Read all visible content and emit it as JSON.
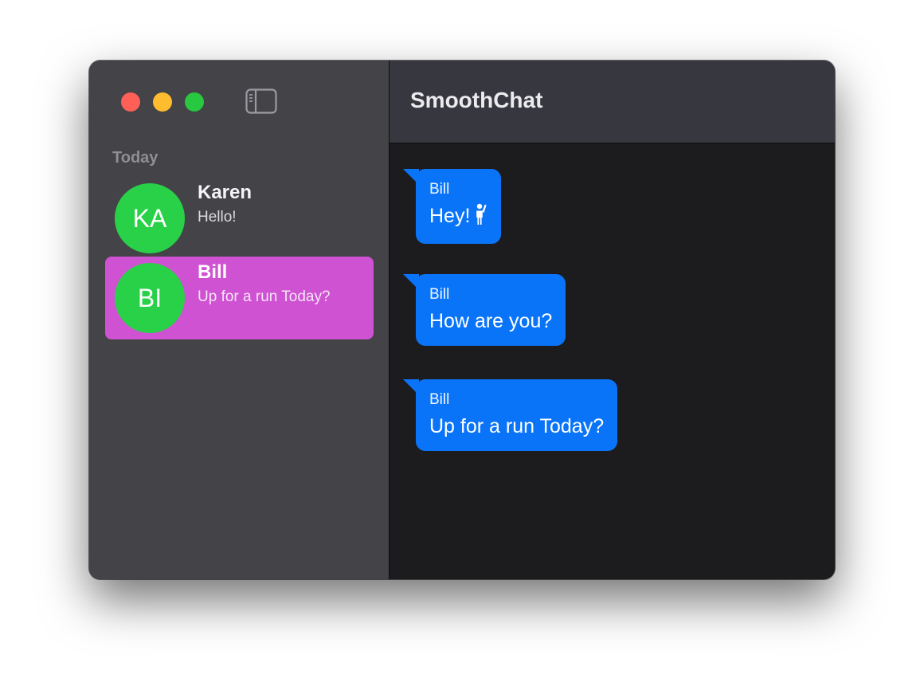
{
  "window": {
    "traffic_lights": [
      "close",
      "minimize",
      "zoom"
    ],
    "sidebar_toggle_icon": "sidebar-toggle-icon"
  },
  "sidebar": {
    "section_header": "Today",
    "conversations": [
      {
        "initials": "KA",
        "name": "Karen",
        "preview": "Hello!",
        "selected": false,
        "avatar_color": "#29d148"
      },
      {
        "initials": "BI",
        "name": "Bill",
        "preview": "Up for a run Today?",
        "selected": true,
        "avatar_color": "#29d148",
        "highlight_color": "#cf52d2"
      }
    ]
  },
  "main": {
    "title": "SmoothChat",
    "messages": [
      {
        "sender": "Bill",
        "text": "Hey!",
        "icon": "person-raising-hand-icon"
      },
      {
        "sender": "Bill",
        "text": "How are you?"
      },
      {
        "sender": "Bill",
        "text": "Up for a run Today?"
      }
    ]
  },
  "colors": {
    "accent_blue": "#0a74f9",
    "selection_magenta": "#cf52d2",
    "avatar_green": "#29d148"
  }
}
